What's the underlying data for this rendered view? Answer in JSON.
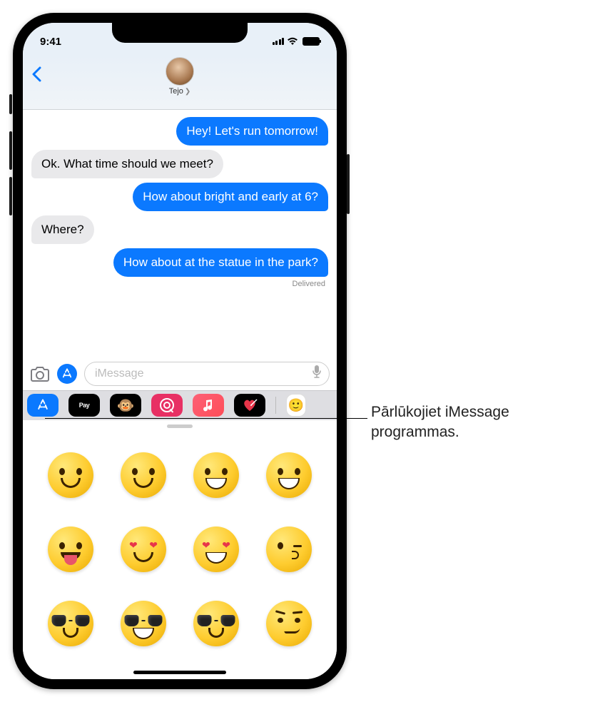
{
  "status": {
    "time": "9:41"
  },
  "header": {
    "contact_name": "Tejo"
  },
  "chat": {
    "m1": "Hey! Let's run tomorrow!",
    "m2": "Ok. What time should we meet?",
    "m3": "How about bright and early at 6?",
    "m4": "Where?",
    "m5": "How about at the statue in the park?",
    "delivered": "Delivered"
  },
  "compose": {
    "placeholder": "iMessage"
  },
  "app_drawer": {
    "apple_pay": "Pay"
  },
  "callout": {
    "text": "Pārlūkojiet iMessage programmas."
  }
}
